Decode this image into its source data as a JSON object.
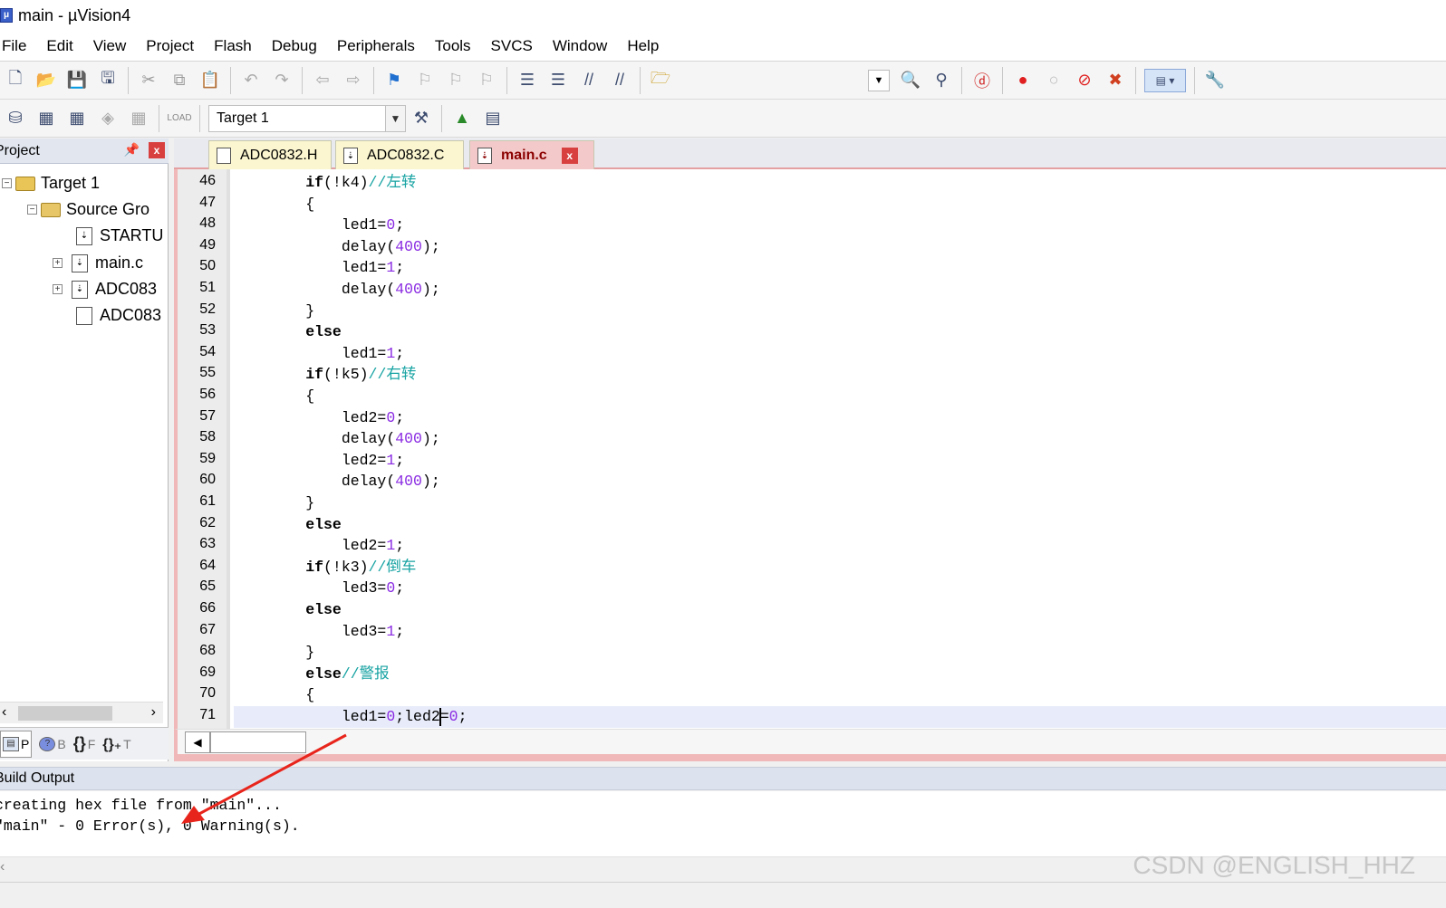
{
  "window": {
    "title": "main  - µVision4"
  },
  "menu": [
    "File",
    "Edit",
    "View",
    "Project",
    "Flash",
    "Debug",
    "Peripherals",
    "Tools",
    "SVCS",
    "Window",
    "Help"
  ],
  "toolbar2": {
    "target": "Target 1"
  },
  "project": {
    "header": "Project",
    "tree": [
      {
        "label": "Target 1"
      },
      {
        "label": "Source Gro"
      },
      {
        "label": "STARTU"
      },
      {
        "label": "main.c"
      },
      {
        "label": "ADC083"
      },
      {
        "label": "ADC083"
      }
    ],
    "tabs": [
      "P",
      "B",
      "F",
      "T"
    ]
  },
  "editor": {
    "tabs": [
      {
        "label": "ADC0832.H"
      },
      {
        "label": "ADC0832.C"
      },
      {
        "label": "main.c"
      }
    ],
    "line_numbers": [
      "46",
      "47",
      "48",
      "49",
      "50",
      "51",
      "52",
      "53",
      "54",
      "55",
      "56",
      "57",
      "58",
      "59",
      "60",
      "61",
      "62",
      "63",
      "64",
      "65",
      "66",
      "67",
      "68",
      "69",
      "70",
      "71"
    ]
  },
  "build_output": {
    "header": "Build Output",
    "lines": [
      "creating hex file from \"main\"...",
      "\"main\" - 0 Error(s), 0 Warning(s)."
    ]
  },
  "watermark": "CSDN @ENGLISH_HHZ",
  "colors": {
    "comment": "#19a3a3",
    "number": "#8a2be2",
    "arrow": "#e8251c",
    "active_tab": "#f3c9c9"
  }
}
